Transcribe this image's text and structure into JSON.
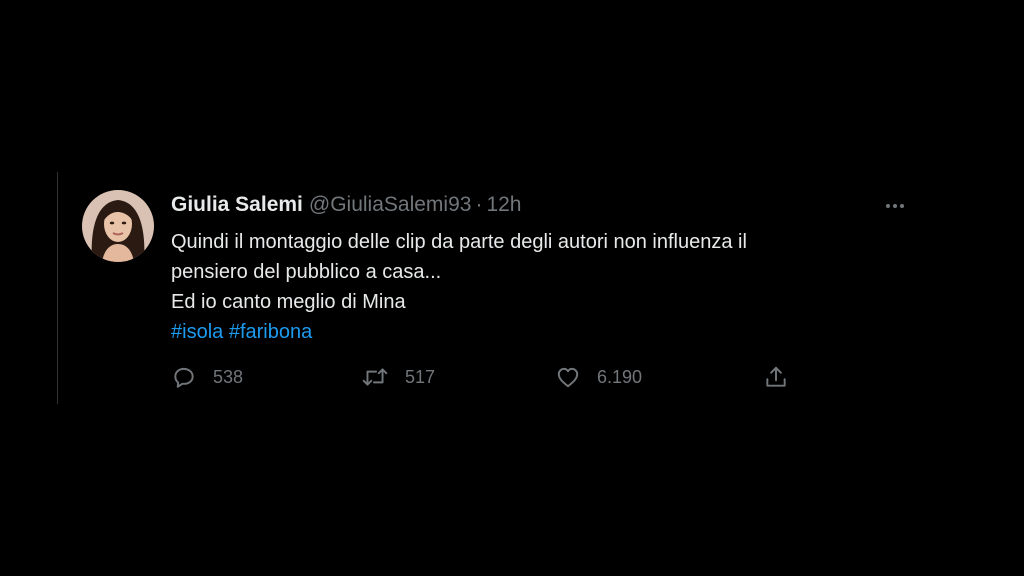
{
  "tweet": {
    "author": {
      "display_name": "Giulia Salemi",
      "handle": "@GiuliaSalemi93",
      "separator": "·",
      "time": "12h"
    },
    "text_lines": [
      "Quindi il montaggio delle clip da parte degli autori non influenza il",
      "pensiero del pubblico a casa...",
      "Ed io canto meglio di Mina"
    ],
    "hashtags": [
      "#isola",
      "#faribona"
    ],
    "actions": {
      "reply_count": "538",
      "retweet_count": "517",
      "like_count": "6.190"
    },
    "icons": {
      "more": "more-horizontal-icon",
      "reply": "reply-bubble-icon",
      "retweet": "retweet-arrows-icon",
      "like": "heart-icon",
      "share": "share-upload-icon"
    }
  },
  "colors": {
    "background": "#000000",
    "primary_text": "#e7e9ea",
    "secondary_text": "#71767b",
    "hashtag": "#1d9bf0",
    "border": "#2f3336"
  }
}
